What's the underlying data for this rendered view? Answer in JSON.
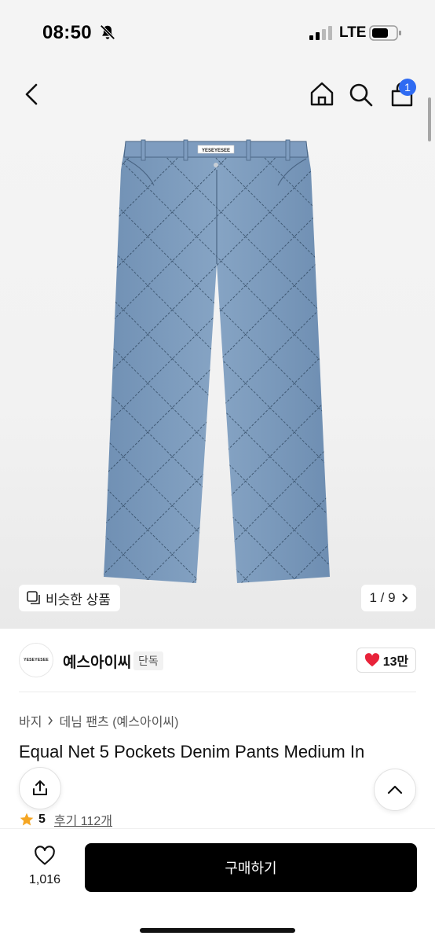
{
  "status_bar": {
    "time": "08:50",
    "network": "LTE"
  },
  "nav": {
    "cart_count": "1"
  },
  "gallery": {
    "similar_label": "비슷한 상품",
    "counter": "1 / 9"
  },
  "brand": {
    "logo_text": "YESEYESEE",
    "name": "예스아이씨",
    "tag": "단독",
    "likes": "13만"
  },
  "breadcrumb": {
    "category": "바지",
    "subcategory": "데님 팬츠 (예스아이씨)"
  },
  "product": {
    "title": "Equal Net 5 Pockets Denim Pants Medium In",
    "rating": "5",
    "reviews": "후기 112개",
    "waist_label": "YESEYESEE"
  },
  "bottom": {
    "wish_count": "1,016",
    "buy_label": "구매하기"
  },
  "colors": {
    "accent_badge": "#2f6bf2",
    "like_red": "#e8233a",
    "star": "#f5a623",
    "denim": "#7d9bbd"
  }
}
